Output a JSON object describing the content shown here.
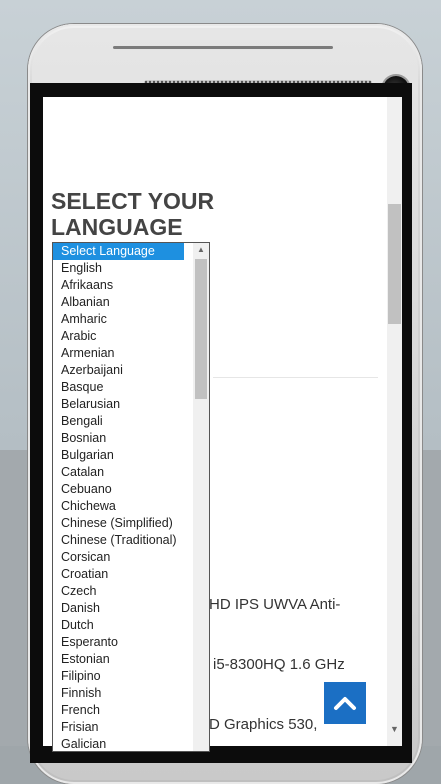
{
  "screen": {
    "heading": "SELECT YOUR LANGUAGE",
    "partial_lines": [
      "HD IPS UWVA Anti-",
      "i5-8300HQ 1.6 GHz",
      "D Graphics 530,"
    ]
  },
  "language_select": {
    "selected": "Select Language",
    "options": [
      "Select Language",
      "English",
      "Afrikaans",
      "Albanian",
      "Amharic",
      "Arabic",
      "Armenian",
      "Azerbaijani",
      "Basque",
      "Belarusian",
      "Bengali",
      "Bosnian",
      "Bulgarian",
      "Catalan",
      "Cebuano",
      "Chichewa",
      "Chinese (Simplified)",
      "Chinese (Traditional)",
      "Corsican",
      "Croatian",
      "Czech",
      "Danish",
      "Dutch",
      "Esperanto",
      "Estonian",
      "Filipino",
      "Finnish",
      "French",
      "Frisian",
      "Galician"
    ]
  },
  "icons": {
    "back_to_top": "chevron-up-icon"
  },
  "colors": {
    "accent": "#1b6fc4",
    "selected_option": "#1e90e0",
    "heading": "#444444"
  }
}
